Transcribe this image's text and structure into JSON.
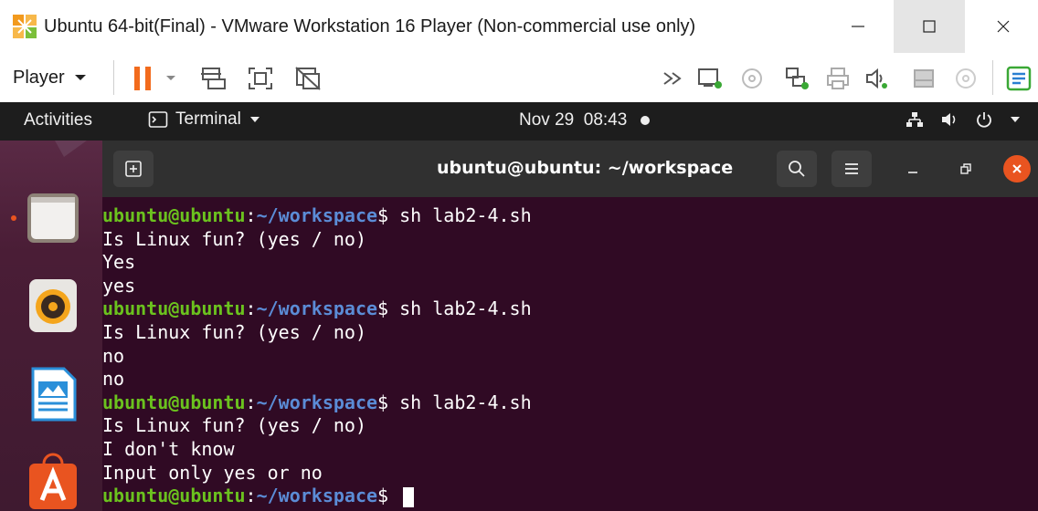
{
  "window": {
    "title": "Ubuntu 64-bit(Final) - VMware Workstation 16 Player (Non-commercial use only)",
    "icons": [
      "vmware-logo-icon",
      "minimize-icon",
      "maximize-icon",
      "close-icon"
    ]
  },
  "toolbar": {
    "player_label": "Player",
    "icons": [
      "pause-icon",
      "send-ctrl-alt-del-icon",
      "fullscreen-icon",
      "unity-icon",
      "forward-icon",
      "network-icon",
      "cd-icon",
      "usb-icon",
      "printer-icon",
      "sound-icon",
      "hdd-icon",
      "disc-icon",
      "notes-icon"
    ]
  },
  "gnome_bar": {
    "activities": "Activities",
    "app_menu": "Terminal",
    "clock": "Nov 29  08:43",
    "tray_icons": [
      "network-icon",
      "volume-icon",
      "power-icon"
    ]
  },
  "dock": {
    "items": [
      "files-icon",
      "rhythmbox-icon",
      "libreoffice-writer-icon",
      "software-icon"
    ]
  },
  "terminal": {
    "title": "ubuntu@ubuntu: ~/workspace",
    "prompt_user": "ubuntu@ubuntu",
    "prompt_colon": ":",
    "prompt_path": "~/workspace",
    "prompt_dollar": "$",
    "lines": [
      {
        "type": "prompt",
        "command": " sh lab2-4.sh"
      },
      {
        "type": "output",
        "text": "Is Linux fun? (yes / no)"
      },
      {
        "type": "output",
        "text": "Yes"
      },
      {
        "type": "output",
        "text": "yes"
      },
      {
        "type": "prompt",
        "command": " sh lab2-4.sh"
      },
      {
        "type": "output",
        "text": "Is Linux fun? (yes / no)"
      },
      {
        "type": "output",
        "text": "no"
      },
      {
        "type": "output",
        "text": "no"
      },
      {
        "type": "prompt",
        "command": " sh lab2-4.sh"
      },
      {
        "type": "output",
        "text": "Is Linux fun? (yes / no)"
      },
      {
        "type": "output",
        "text": "I don't know"
      },
      {
        "type": "output",
        "text": "Input only yes or no"
      },
      {
        "type": "prompt",
        "command": " "
      }
    ]
  },
  "colors": {
    "terminal_bg": "#300a24",
    "prompt_user": "#6bc21e",
    "prompt_path": "#5b8cd6",
    "close_button": "#e95420"
  }
}
